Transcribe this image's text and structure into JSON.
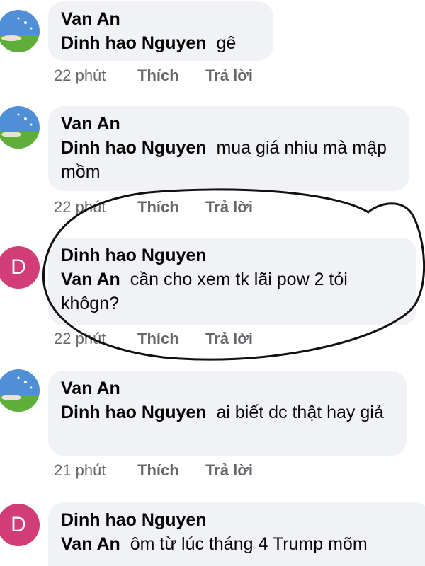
{
  "comments": [
    {
      "author": "Van An",
      "mention": "Dinh hao Nguyen",
      "text": "gê",
      "time": "22 phút",
      "like": "Thích",
      "reply": "Trả lời",
      "avatar": "landscape-avatar"
    },
    {
      "author": "Van An",
      "mention": "Dinh hao Nguyen",
      "text": "mua giá nhiu mà mập mồm",
      "time": "22 phút",
      "like": "Thích",
      "reply": "Trả lời",
      "avatar": "landscape-avatar"
    },
    {
      "author": "Dinh hao Nguyen",
      "mention": "Van An",
      "text": "cần cho xem tk lãi pow 2 tỏi khôgn?",
      "time": "22 phút",
      "like": "Thích",
      "reply": "Trả lời",
      "avatar_letter": "D"
    },
    {
      "author": "Van An",
      "mention": "Dinh hao Nguyen",
      "text": "ai biết dc thật hay giả",
      "time": "21 phút",
      "like": "Thích",
      "reply": "Trả lời",
      "avatar": "landscape-avatar"
    },
    {
      "author": "Dinh hao Nguyen",
      "mention": "Van An",
      "text": "ôm từ lúc tháng 4 Trump mõm",
      "avatar_letter": "D"
    }
  ],
  "colors": {
    "bubble": "#f0f2f5",
    "meta_text": "#65676b",
    "avatar_letter_bg": "#d23c77",
    "annotation_ink": "#111111"
  }
}
